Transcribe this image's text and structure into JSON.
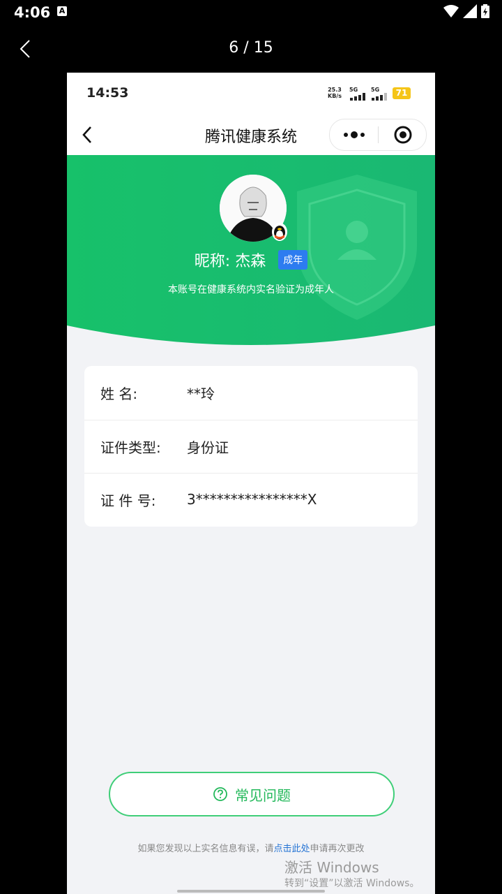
{
  "os_status": {
    "time": "4:06",
    "notif_letter": "A"
  },
  "viewer": {
    "counter": "6 / 15"
  },
  "inner_status": {
    "time": "14:53",
    "speed": "25.3",
    "speed_unit": "KB/s",
    "net1": "5G",
    "net2": "5G",
    "battery": "71"
  },
  "navbar": {
    "title": "腾讯健康系统"
  },
  "profile": {
    "nickname": "昵称:  杰森",
    "badge": "成年",
    "note": "本账号在健康系统内实名验证为成年人"
  },
  "info": {
    "rows": [
      {
        "label": "姓        名:",
        "value": "**玲"
      },
      {
        "label": "证件类型:",
        "value": "身份证"
      },
      {
        "label": "证   件   号:",
        "value": "3****************X"
      }
    ]
  },
  "faq": {
    "label": "常见问题"
  },
  "footer": {
    "prefix": "如果您发现以上实名信息有误，请",
    "link": "点击此处",
    "suffix": "申请再次更改"
  },
  "watermark": {
    "line1": "激活 Windows",
    "line2": "转到“设置”以激活 Windows。"
  },
  "colors": {
    "green": "#1fc16b",
    "accent_blue": "#2d7cf0"
  }
}
